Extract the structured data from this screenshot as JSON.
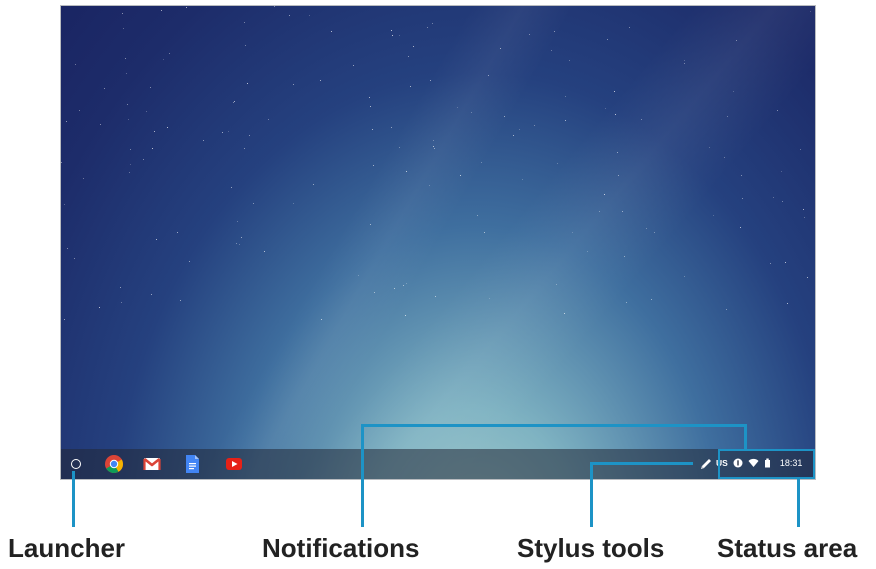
{
  "shelf": {
    "apps": [
      {
        "name": "chrome-icon"
      },
      {
        "name": "gmail-icon"
      },
      {
        "name": "docs-icon"
      },
      {
        "name": "youtube-icon"
      }
    ],
    "stylus_icon": "pen-icon"
  },
  "status_area": {
    "ime": "US",
    "notification_icon": "notification-badge-icon",
    "wifi_icon": "wifi-icon",
    "battery_icon": "battery-icon",
    "time": "18:31"
  },
  "labels": {
    "launcher": "Launcher",
    "notifications": "Notifications",
    "stylus_tools": "Stylus tools",
    "status_area": "Status area"
  },
  "colors": {
    "callout": "#1d93c6",
    "shelf": "#232837",
    "wallpaper_top": "#1a2563",
    "wallpaper_bottom": "#a8cfcf"
  }
}
